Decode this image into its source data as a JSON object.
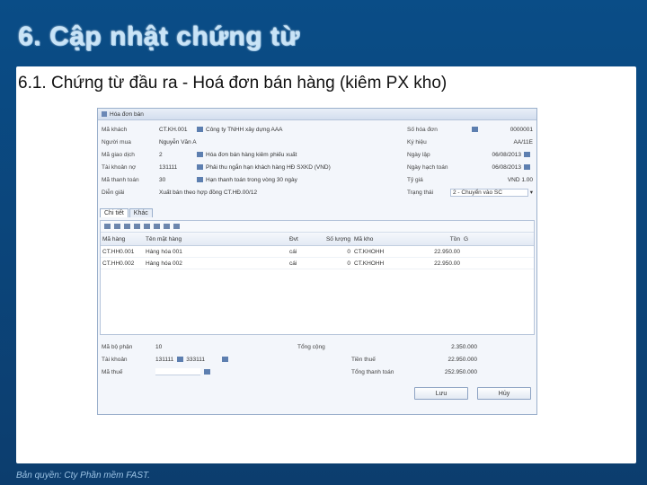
{
  "slide": {
    "title": "6. Cập nhật chứng từ",
    "subtitle": "6.1. Chứng từ đầu ra - Hoá đơn bán hàng (kiêm PX kho)",
    "copyright": "Bản quyền: Cty Phần mềm FAST."
  },
  "window": {
    "title": "Hóa đơn bán",
    "left_fields": [
      {
        "label": "Mã khách",
        "value": "CT.KH.001"
      },
      {
        "label": "Người mua",
        "value": "Nguyễn Văn A"
      },
      {
        "label": "Mã giao dịch",
        "value": "2"
      },
      {
        "label": "Tài khoản nợ",
        "value": "131111"
      },
      {
        "label": "Mã thanh toán",
        "value": "30"
      },
      {
        "label": "Diễn giải",
        "value": "Xuất bán theo hợp đồng CT.HĐ.00/12"
      }
    ],
    "mid_fields": [
      {
        "value": "Công ty TNHH xây dựng AAA"
      },
      {
        "value": ""
      },
      {
        "value": "Hóa đơn bán hàng kiêm phiếu xuất"
      },
      {
        "value": "Phải thu ngắn hạn khách hàng HĐ SXKD (VND)"
      },
      {
        "value": "Hạn thanh toán trong vòng 30 ngày"
      }
    ],
    "right_fields": [
      {
        "label": "Số hóa đơn",
        "value": "0000001"
      },
      {
        "label": "Ký hiệu",
        "value": "AA/11E"
      },
      {
        "label": "Ngày lập",
        "value": "06/08/2013"
      },
      {
        "label": "Ngày hạch toán",
        "value": "06/08/2013"
      },
      {
        "label": "Tỷ giá",
        "value": "VND 1.00"
      },
      {
        "label": "Trạng thái",
        "value": "2 - Chuyển vào SC"
      }
    ],
    "tabs": [
      "Chi tiết",
      "Khác"
    ],
    "grid": {
      "headers": [
        "Mã hàng",
        "Tên mặt hàng",
        "Đvt",
        "Số lượng",
        "Mã kho",
        "Tồn",
        "G"
      ],
      "rows": [
        [
          "CT.HH0.001",
          "Hàng hóa 001",
          "cái",
          "0",
          "CT.KHOHH",
          "22.950.00",
          ""
        ],
        [
          "CT.HH0.002",
          "Hàng hóa 002",
          "cái",
          "0",
          "CT.KHOHH",
          "22.950.00",
          ""
        ]
      ]
    },
    "footer": {
      "left": [
        {
          "label": "Mã bộ phận",
          "value": "10"
        },
        {
          "label": "Tài khoản",
          "value": "131111"
        },
        {
          "label": "Mã thuế",
          "value": ""
        }
      ],
      "mid_value": "333111",
      "totals_label": "Tổng cộng",
      "totals": [
        {
          "label": "Tổng cộng",
          "value": "2.350.000"
        },
        {
          "label": "Tiền thuế",
          "value": "22.950.000"
        },
        {
          "label": "Tổng thanh toán",
          "value": "252.950.000"
        }
      ]
    },
    "buttons": {
      "save": "Lưu",
      "cancel": "Hủy"
    }
  }
}
